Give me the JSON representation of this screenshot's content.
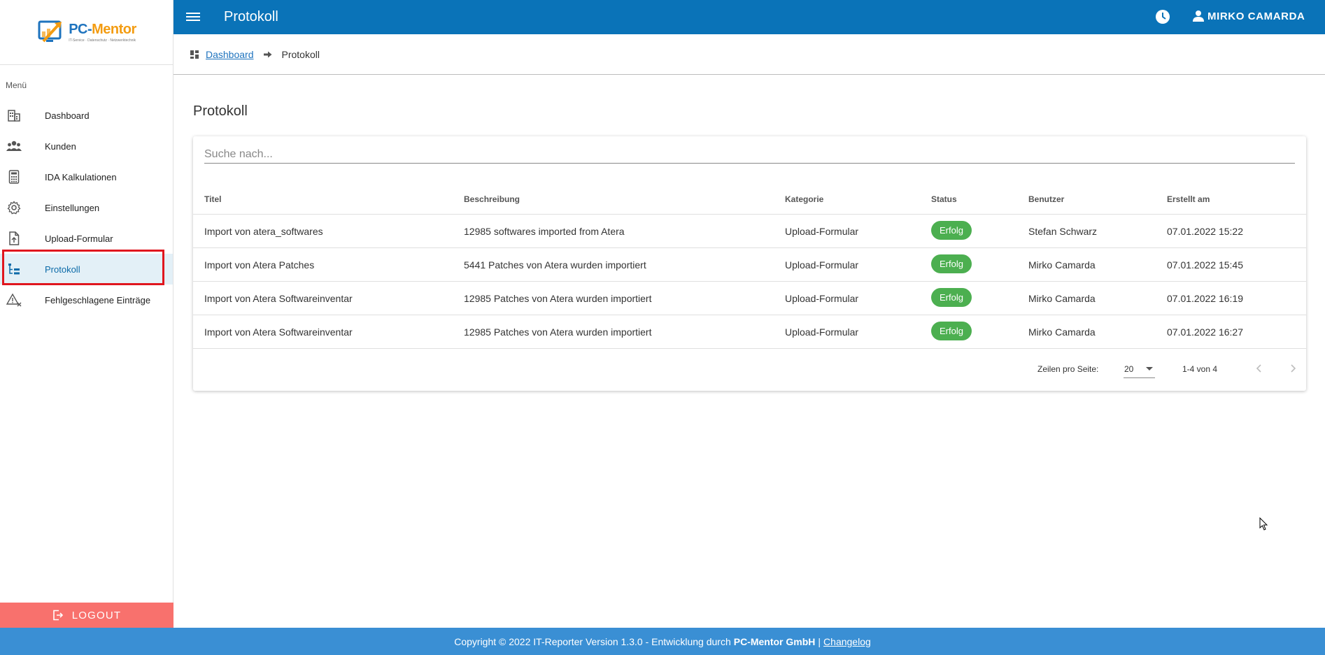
{
  "sidebar": {
    "logo": {
      "name_part1": "PC-",
      "name_part2": "Mentor",
      "tagline": "IT-Service · Datenschutz · Netzwerktechnik"
    },
    "menu_caption": "Menü",
    "items": [
      {
        "label": "Dashboard",
        "icon": "building-icon"
      },
      {
        "label": "Kunden",
        "icon": "group-icon"
      },
      {
        "label": "IDA Kalkulationen",
        "icon": "calculator-icon"
      },
      {
        "label": "Einstellungen",
        "icon": "gear-icon"
      },
      {
        "label": "Upload-Formular",
        "icon": "upload-file-icon"
      },
      {
        "label": "Protokoll",
        "icon": "tree-list-icon",
        "active": true
      },
      {
        "label": "Fehlgeschlagene Einträge",
        "icon": "warning-x-icon"
      }
    ],
    "logout_label": "LOGOUT"
  },
  "topbar": {
    "title": "Protokoll",
    "user_name": "MIRKO CAMARDA"
  },
  "breadcrumb": {
    "home": "Dashboard",
    "current": "Protokoll"
  },
  "main": {
    "heading": "Protokoll",
    "search_placeholder": "Suche nach...",
    "columns": [
      "Titel",
      "Beschreibung",
      "Kategorie",
      "Status",
      "Benutzer",
      "Erstellt am"
    ],
    "rows": [
      {
        "title": "Import von atera_softwares",
        "desc": "12985 softwares imported from Atera",
        "category": "Upload-Formular",
        "status": "Erfolg",
        "user": "Stefan Schwarz",
        "date": "07.01.2022 15:22"
      },
      {
        "title": "Import von Atera Patches",
        "desc": "5441 Patches von Atera wurden importiert",
        "category": "Upload-Formular",
        "status": "Erfolg",
        "user": "Mirko Camarda",
        "date": "07.01.2022 15:45"
      },
      {
        "title": "Import von Atera Softwareinventar",
        "desc": "12985 Patches von Atera wurden importiert",
        "category": "Upload-Formular",
        "status": "Erfolg",
        "user": "Mirko Camarda",
        "date": "07.01.2022 16:19"
      },
      {
        "title": "Import von Atera Softwareinventar",
        "desc": "12985 Patches von Atera wurden importiert",
        "category": "Upload-Formular",
        "status": "Erfolg",
        "user": "Mirko Camarda",
        "date": "07.01.2022 16:27"
      }
    ],
    "pagination": {
      "rows_per_page_label": "Zeilen pro Seite:",
      "rows_per_page": "20",
      "range": "1-4 von 4"
    }
  },
  "footer": {
    "text_prefix": "Copyright © 2022 IT-Reporter Version 1.3.0 - Entwicklung durch",
    "company": "PC-Mentor GmbH",
    "separator": "|",
    "changelog": "Changelog"
  },
  "colors": {
    "topbar": "#0a73b8",
    "footer": "#3a8fd4",
    "logout": "#f8716d",
    "success": "#4caf50",
    "highlight": "#e0161e"
  }
}
